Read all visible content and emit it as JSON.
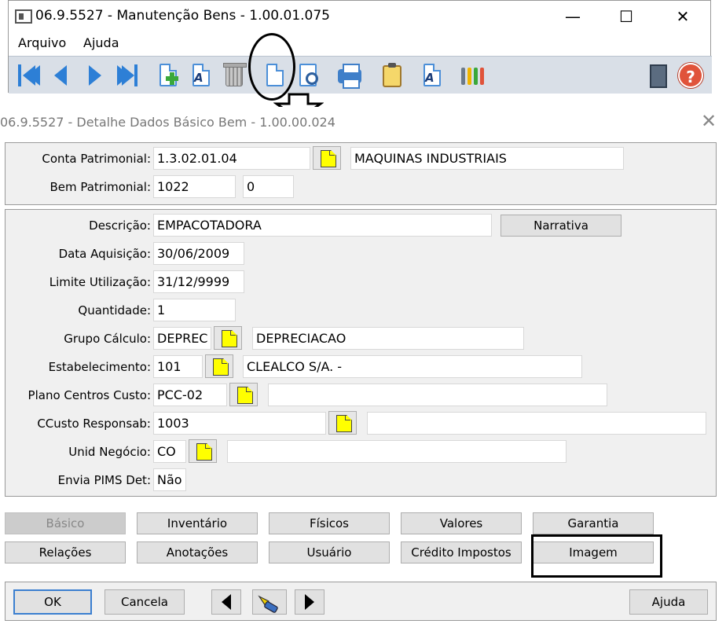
{
  "main_window": {
    "title": "06.9.5527 - Manutenção Bens - 1.00.01.075",
    "minimize": "—",
    "maximize": "☐",
    "close": "✕",
    "menu": [
      "Arquivo",
      "Ajuda"
    ],
    "help_icon_text": "?"
  },
  "detail_window": {
    "title": "06.9.5527 - Detalhe Dados Básico Bem - 1.00.00.024",
    "close": "✕",
    "top": {
      "conta_label": "Conta Patrimonial:",
      "conta_value": "1.3.02.01.04",
      "conta_desc": "MAQUINAS INDUSTRIAIS",
      "bem_label": "Bem Patrimonial:",
      "bem_value": "1022",
      "bem_seq": "0"
    },
    "fields": {
      "descricao_label": "Descrição:",
      "descricao_value": "EMPACOTADORA",
      "narrativa_button": "Narrativa",
      "data_aq_label": "Data Aquisição:",
      "data_aq_value": "30/06/2009",
      "limite_label": "Limite Utilização:",
      "limite_value": "31/12/9999",
      "quantidade_label": "Quantidade:",
      "quantidade_value": "1",
      "grupo_label": "Grupo Cálculo:",
      "grupo_value": "DEPREC",
      "grupo_desc": "DEPRECIACAO",
      "estab_label": "Estabelecimento:",
      "estab_value": "101",
      "estab_desc": "CLEALCO S/A. -",
      "plano_label": "Plano Centros Custo:",
      "plano_value": "PCC-02",
      "plano_desc": "",
      "ccusto_label": "CCusto Responsab:",
      "ccusto_value": "1003",
      "ccusto_desc": "",
      "unid_label": "Unid Negócio:",
      "unid_value": "CO",
      "unid_desc": "",
      "envia_label": "Envia PIMS Det:",
      "envia_value": "Não"
    },
    "tabs_row1": [
      "Básico",
      "Inventário",
      "Físicos",
      "Valores",
      "Garantia"
    ],
    "tabs_row2": [
      "Relações",
      "Anotações",
      "Usuário",
      "Crédito Impostos",
      "Imagem"
    ],
    "bottom": {
      "ok": "OK",
      "cancela": "Cancela",
      "ajuda": "Ajuda"
    }
  }
}
